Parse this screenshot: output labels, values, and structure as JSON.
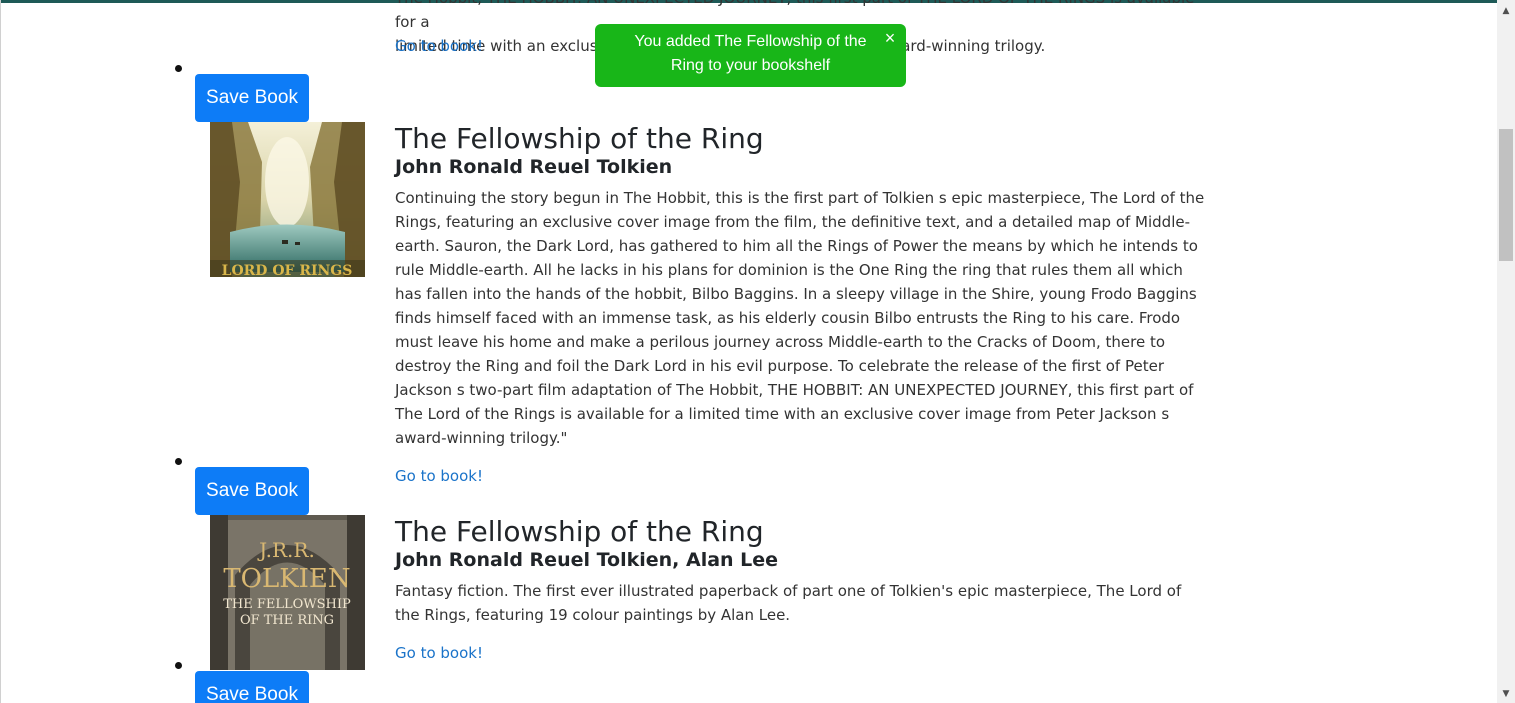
{
  "toast": {
    "message": "You added The Fellowship of the Ring to your bookshelf",
    "close_icon": "×",
    "color": "#18b618"
  },
  "previous_item": {
    "desc_tail_line1": "The Hobbit, THE HOBBIT: AN UNEXPECTED JOURNEY, this first part of THE LORD OF THE RINGS is available for a",
    "desc_tail_line2": "limited time with an exclusive cover image from Peter Jackson's award-winning trilogy.",
    "link_label": "Go to book!"
  },
  "books": [
    {
      "save_label": "Save Book",
      "title": "The Fellowship of the Ring",
      "authors": "John Ronald Reuel Tolkien",
      "description": "Continuing the story begun in The Hobbit, this is the first part of Tolkien s epic masterpiece, The Lord of the Rings, featuring an exclusive cover image from the film, the definitive text, and a detailed map of Middle-earth. Sauron, the Dark Lord, has gathered to him all the Rings of Power the means by which he intends to rule Middle-earth. All he lacks in his plans for dominion is the One Ring the ring that rules them all which has fallen into the hands of the hobbit, Bilbo Baggins. In a sleepy village in the Shire, young Frodo Baggins finds himself faced with an immense task, as his elderly cousin Bilbo entrusts the Ring to his care. Frodo must leave his home and make a perilous journey across Middle-earth to the Cracks of Doom, there to destroy the Ring and foil the Dark Lord in his evil purpose. To celebrate the release of the first of Peter Jackson s two-part film adaptation of The Hobbit, THE HOBBIT: AN UNEXPECTED JOURNEY, this first part of The Lord of the Rings is available for a limited time with an exclusive cover image from Peter Jackson s award-winning trilogy.\"",
      "link_label": "Go to book!",
      "cover_text": "LORD OF RINGS"
    },
    {
      "save_label": "Save Book",
      "title": "The Fellowship of the Ring",
      "authors": "John Ronald Reuel Tolkien, Alan Lee",
      "description": "Fantasy fiction. The first ever illustrated paperback of part one of Tolkien's epic masterpiece, The Lord of the Rings, featuring 19 colour paintings by Alan Lee.",
      "link_label": "Go to book!",
      "cover_author": "J.R.R.",
      "cover_surname": "TOLKIEN",
      "cover_title_1": "THE FELLOWSHIP",
      "cover_title_2": "OF THE RING"
    },
    {
      "save_label": "Save Book"
    }
  ]
}
